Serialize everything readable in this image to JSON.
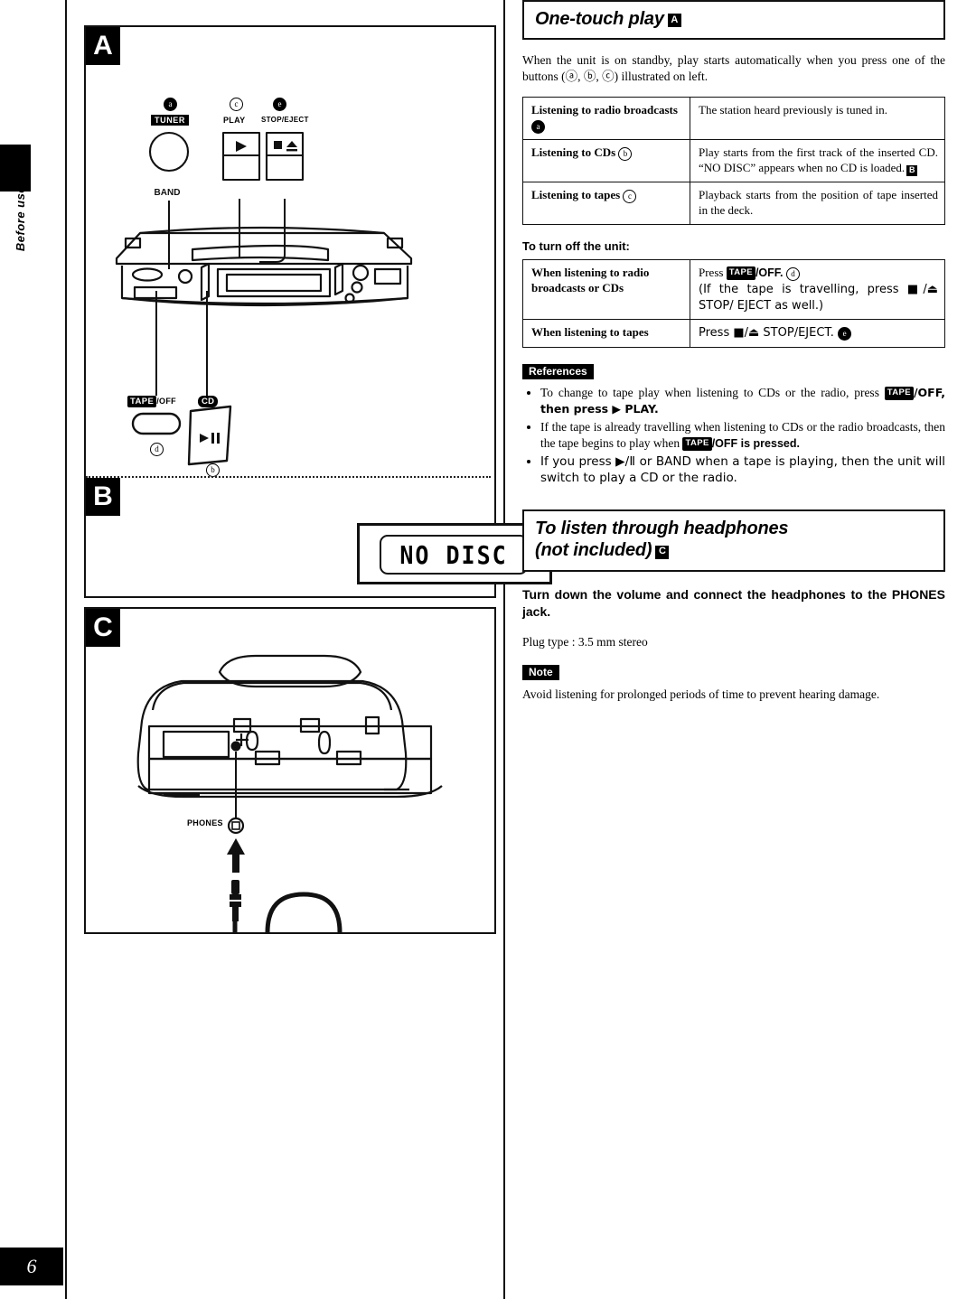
{
  "page": {
    "number": "6",
    "side_tab": "Before use"
  },
  "illustrations": {
    "a": {
      "badge": "A",
      "labels": {
        "tuner": "TUNER",
        "band": "BAND",
        "play": "PLAY",
        "stop_eject": "STOP/EJECT",
        "play_glyph": "▶",
        "stop_eject_glyph": "■/⏏",
        "tape_off": "/OFF",
        "tape_badge": "TAPE",
        "cd_badge": "CD",
        "cd_play_pause_glyph": "▶/Ⅱ"
      },
      "callouts": {
        "a": "a",
        "b": "b",
        "c": "c",
        "d": "d",
        "e": "e"
      }
    },
    "b": {
      "badge": "B",
      "display_text": "NO DISC"
    },
    "c": {
      "badge": "C",
      "phones_label": "PHONES"
    }
  },
  "section_one": {
    "title": "One-touch play",
    "title_badge": "A",
    "intro": "When the unit is on standby, play starts automatically when you press one of the buttons (ⓐ, ⓑ, ⓒ) illustrated on left.",
    "table": [
      {
        "key": "Listening to radio broadcasts",
        "key_callout": "a",
        "value": "The station heard previously is tuned in."
      },
      {
        "key": "Listening to CDs",
        "key_callout": "b",
        "value": "Play starts from the first track of the inserted CD. “NO DISC” appears when no CD is loaded.",
        "value_badge": "B"
      },
      {
        "key": "Listening to tapes",
        "key_callout": "c",
        "value": "Playback starts from the position of tape inserted in the deck."
      }
    ],
    "turn_off_heading": "To turn off the unit:",
    "turn_off_table": [
      {
        "key": "When listening to radio broadcasts or CDs",
        "value_pre": "Press ",
        "value_badge": "TAPE",
        "value_post": "/OFF. ",
        "value_callout": "d",
        "value_line2": "(If the tape is travelling, press ■/⏏ STOP/ EJECT as well.)"
      },
      {
        "key": "When listening to tapes",
        "value_pre": "Press ■/⏏ STOP/EJECT. ",
        "value_callout": "e"
      }
    ],
    "references_label": "References",
    "references": [
      {
        "pre": "To change to tape play when listening to CDs or the radio, press ",
        "badge": "TAPE",
        "post": "/OFF, then press ▶ PLAY."
      },
      {
        "pre": "If the tape is already travelling when listening to CDs or the radio broadcasts, then the tape begins to play when ",
        "badge": "TAPE",
        "post": "/OFF is pressed."
      },
      {
        "pre": "If you press ▶/Ⅱ or BAND when a tape is playing, then the unit will switch to play a CD or the radio.",
        "badge": "",
        "post": ""
      }
    ]
  },
  "section_two": {
    "title_line1": "To listen through headphones",
    "title_line2": "(not included)",
    "title_badge": "C",
    "bold_instruction": "Turn down the volume and connect the headphones to the PHONES jack.",
    "plug_type": "Plug type : 3.5 mm stereo",
    "note_label": "Note",
    "note_text": "Avoid listening for prolonged periods of time to prevent hearing damage."
  }
}
